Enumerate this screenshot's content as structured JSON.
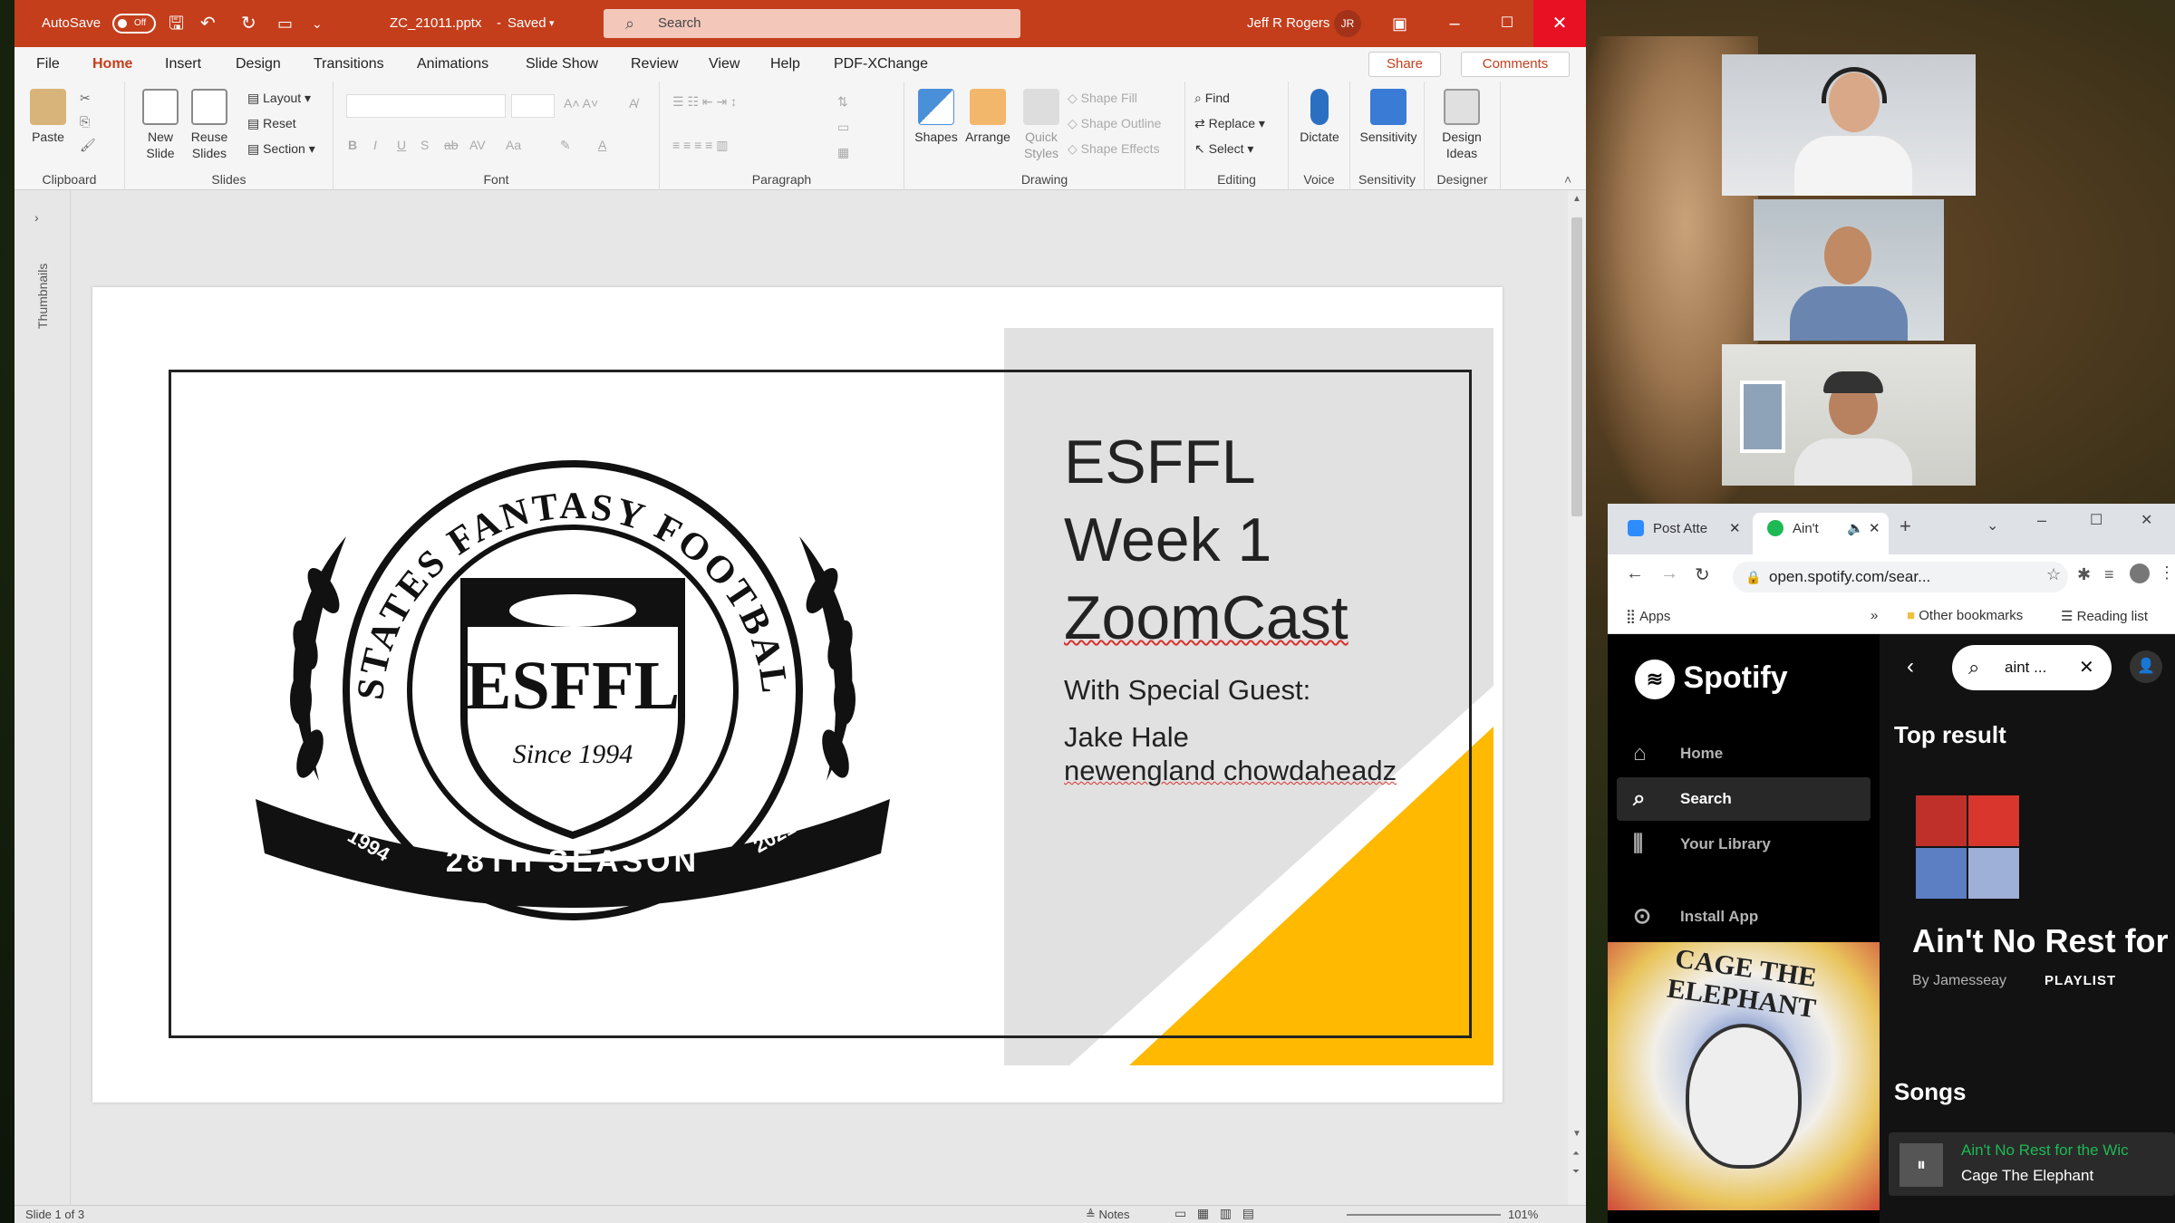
{
  "powerpoint": {
    "autosave_label": "AutoSave",
    "autosave_state": "Off",
    "filename": "ZC_21011.pptx",
    "save_status": "Saved",
    "search_placeholder": "Search",
    "user_name": "Jeff R Rogers",
    "user_initials": "JR",
    "menu": [
      "File",
      "Home",
      "Insert",
      "Design",
      "Transitions",
      "Animations",
      "Slide Show",
      "Review",
      "View",
      "Help",
      "PDF-XChange"
    ],
    "share_label": "Share",
    "comments_label": "Comments",
    "ribbon": {
      "clipboard": {
        "paste": "Paste",
        "group": "Clipboard"
      },
      "slides": {
        "new_slide": "New Slide",
        "reuse_slides": "Reuse Slides",
        "layout": "Layout",
        "reset": "Reset",
        "section": "Section",
        "group": "Slides"
      },
      "font": {
        "group": "Font"
      },
      "paragraph": {
        "group": "Paragraph"
      },
      "drawing": {
        "shapes": "Shapes",
        "arrange": "Arrange",
        "quick_styles": "Quick Styles",
        "shape_fill": "Shape Fill",
        "shape_outline": "Shape Outline",
        "shape_effects": "Shape Effects",
        "group": "Drawing"
      },
      "editing": {
        "find": "Find",
        "replace": "Replace",
        "select": "Select",
        "group": "Editing"
      },
      "voice": {
        "dictate": "Dictate",
        "group": "Voice"
      },
      "sensitivity": {
        "label": "Sensitivity",
        "group": "Sensitivity"
      },
      "designer": {
        "label": "Design Ideas",
        "group": "Designer"
      }
    },
    "thumbnails_label": "Thumbnails",
    "slide": {
      "title_lines": [
        "ESFFL",
        "Week 1",
        "ZoomCast"
      ],
      "guest_label": "With Special Guest:",
      "guest_name": "Jake Hale",
      "guest_team": "newengland chowdaheadz",
      "logo": {
        "arc_text": "EASTERN STATES FANTASY FOOTBALL LEAGUE",
        "center_text": "ESFFL",
        "since": "Since 1994",
        "banner": "28TH SEASON",
        "year_left": "1994",
        "year_right": "2021"
      },
      "accent_color": "#FFB900"
    },
    "status": {
      "slide_counter": "Slide 1 of 3",
      "notes": "Notes",
      "zoom": "101%"
    }
  },
  "chrome": {
    "tabs": [
      {
        "label": "Post Atte"
      },
      {
        "label": "Ain't"
      }
    ],
    "url": "open.spotify.com/sear...",
    "bookmarks": {
      "apps": "Apps",
      "other": "Other bookmarks",
      "reading": "Reading list"
    }
  },
  "spotify": {
    "brand": "Spotify",
    "nav": [
      "Home",
      "Search",
      "Your Library",
      "Install App"
    ],
    "search_value": "aint ...",
    "top_result_heading": "Top result",
    "top_result_title": "Ain't No Rest for",
    "top_result_by": "By Jamesseay",
    "top_result_type": "PLAYLIST",
    "songs_heading": "Songs",
    "song_title": "Ain't No Rest for the Wic",
    "song_artist": "Cage The Elephant",
    "album_art_text": "CAGE THE ELEPHANT"
  }
}
